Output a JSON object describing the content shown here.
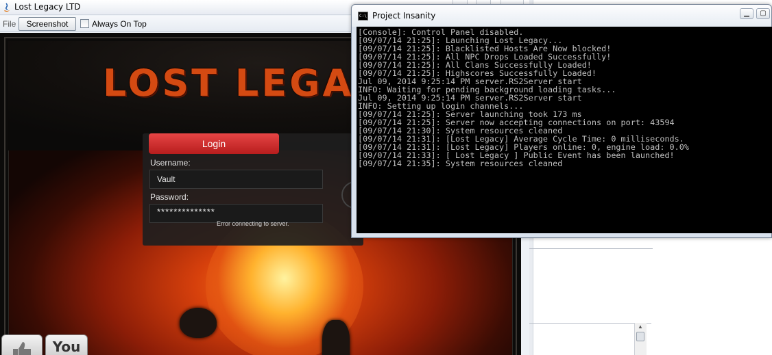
{
  "client": {
    "title": "Lost Legacy LTD",
    "menu": {
      "file": "File",
      "screenshot": "Screenshot",
      "always_on_top": "Always On Top"
    },
    "canvas": {
      "logo_text": "LOST LEGA",
      "login": {
        "header": "Login",
        "username_label": "Username:",
        "username_value": "Vault",
        "password_label": "Password:",
        "password_value": "**************",
        "error": "Error connecting to server."
      },
      "tabs": {
        "you": "You"
      }
    }
  },
  "console": {
    "title": "Project Insanity",
    "lines": [
      "[Console]: Control Panel disabled.",
      "[09/07/14 21:25]: Launching Lost Legacy...",
      "[09/07/14 21:25]: Blacklisted Hosts Are Now blocked!",
      "[09/07/14 21:25]: All NPC Drops Loaded Successfully!",
      "[09/07/14 21:25]: All Clans Successfully Loaded!",
      "[09/07/14 21:25]: Highscores Successfully Loaded!",
      "Jul 09, 2014 9:25:14 PM server.RS2Server start",
      "INFO: Waiting for pending background loading tasks...",
      "Jul 09, 2014 9:25:14 PM server.RS2Server start",
      "INFO: Setting up login channels...",
      "[09/07/14 21:25]: Server launching took 173 ms",
      "[09/07/14 21:25]: Server now accepting connections on port: 43594",
      "[09/07/14 21:30]: System resources cleaned",
      "[09/07/14 21:31]: [Lost Legacy] Average Cycle Time: 0 milliseconds.",
      "[09/07/14 21:31]: [Lost Legacy] Players online: 0, engine load: 0.0%",
      "[09/07/14 21:33]: [ Lost Legacy ] Public Event has been launched!",
      "[09/07/14 21:35]: System resources cleaned"
    ]
  }
}
